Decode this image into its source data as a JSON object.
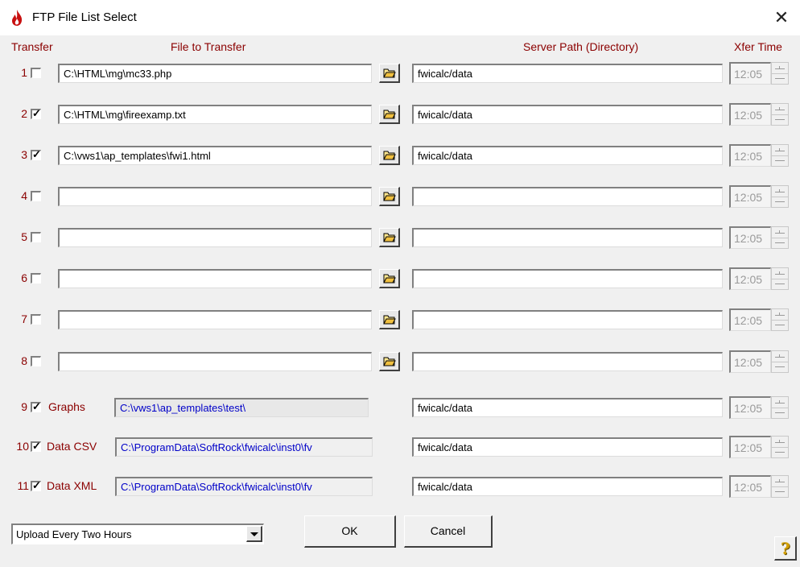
{
  "window": {
    "title": "FTP File List Select",
    "close_glyph": "✕"
  },
  "headers": {
    "transfer": "Transfer",
    "file": "File to Transfer",
    "server": "Server Path (Directory)",
    "xfer_time": "Xfer Time"
  },
  "rows": [
    {
      "num": "1",
      "checked": false,
      "file": "C:\\HTML\\mg\\mc33.php",
      "path": "fwicalc/data",
      "time": "12:05"
    },
    {
      "num": "2",
      "checked": true,
      "file": "C:\\HTML\\mg\\fireexamp.txt",
      "path": "fwicalc/data",
      "time": "12:05"
    },
    {
      "num": "3",
      "checked": true,
      "file": "C:\\vws1\\ap_templates\\fwi1.html",
      "path": "fwicalc/data",
      "time": "12:05"
    },
    {
      "num": "4",
      "checked": false,
      "file": "",
      "path": "",
      "time": "12:05"
    },
    {
      "num": "5",
      "checked": false,
      "file": "",
      "path": "",
      "time": "12:05"
    },
    {
      "num": "6",
      "checked": false,
      "file": "",
      "path": "",
      "time": "12:05"
    },
    {
      "num": "7",
      "checked": false,
      "file": "",
      "path": "",
      "time": "12:05"
    },
    {
      "num": "8",
      "checked": false,
      "file": "",
      "path": "",
      "time": "12:05"
    }
  ],
  "special_rows": [
    {
      "num": "9",
      "checked": true,
      "label": "Graphs",
      "file": "C:\\vws1\\ap_templates\\test\\",
      "path": "fwicalc/data",
      "time": "12:05"
    },
    {
      "num": "10",
      "checked": true,
      "label": "Data CSV",
      "file": "C:\\ProgramData\\SoftRock\\fwicalc\\inst0\\fv",
      "path": "fwicalc/data",
      "time": "12:05"
    },
    {
      "num": "11",
      "checked": true,
      "label": "Data XML",
      "file": "C:\\ProgramData\\SoftRock\\fwicalc\\inst0\\fv",
      "path": "fwicalc/data",
      "time": "12:05"
    }
  ],
  "footer": {
    "schedule": "Upload Every Two Hours",
    "ok": "OK",
    "cancel": "Cancel",
    "help_glyph": "?"
  },
  "colors": {
    "label_red": "#8b0000",
    "readonly_blue": "#0000c8",
    "dialog_bg": "#f0f0f0"
  }
}
